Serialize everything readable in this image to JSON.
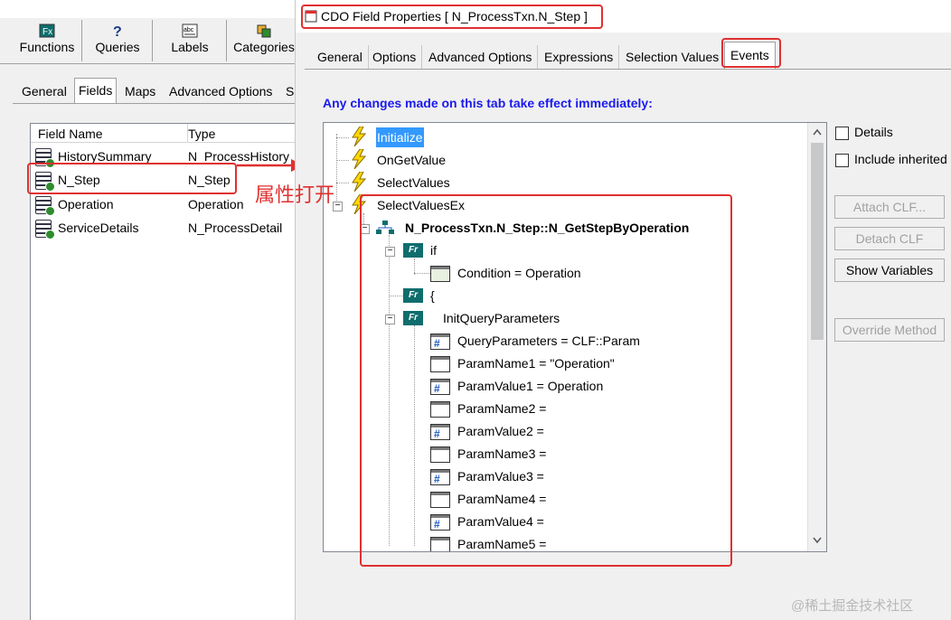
{
  "left": {
    "toolbar": [
      "Functions",
      "Queries",
      "Labels",
      "Categories"
    ],
    "tabs": [
      "General",
      "Fields",
      "Maps",
      "Advanced Options",
      "S"
    ],
    "selected_tab": "Fields",
    "columns": [
      "Field Name",
      "Type"
    ],
    "rows": [
      {
        "name": "HistorySummary",
        "type": "N_ProcessHistory"
      },
      {
        "name": "N_Step",
        "type": "N_Step"
      },
      {
        "name": "Operation",
        "type": "Operation"
      },
      {
        "name": "ServiceDetails",
        "type": "N_ProcessDetail"
      }
    ]
  },
  "annotation": {
    "text": "属性打开",
    "color": "#e03030"
  },
  "dialog": {
    "title": "CDO Field Properties [ N_ProcessTxn.N_Step ]",
    "tabs": [
      "General",
      "Options",
      "Advanced Options",
      "Expressions",
      "Selection Values",
      "Events"
    ],
    "selected_tab": "Events",
    "notice": "Any changes made on this tab take effect immediately:",
    "tree": [
      "Initialize",
      "OnGetValue",
      "SelectValues",
      "SelectValuesEx",
      "N_ProcessTxn.N_Step::N_GetStepByOperation",
      "if",
      "Condition = Operation",
      "{",
      "InitQueryParameters",
      "QueryParameters = CLF::Param",
      "ParamName1 = \"Operation\"",
      "ParamValue1 = Operation",
      "ParamName2 =",
      "ParamValue2 =",
      "ParamName3 =",
      "ParamValue3 =",
      "ParamName4 =",
      "ParamValue4 =",
      "ParamName5 ="
    ],
    "selected_node": "Initialize",
    "checkboxes": [
      {
        "label": "Details",
        "checked": false
      },
      {
        "label": "Include inherited",
        "checked": false
      }
    ],
    "buttons": {
      "attach": "Attach CLF...",
      "detach": "Detach CLF",
      "show_vars": "Show Variables",
      "override": "Override Method"
    }
  },
  "watermark": "@稀土掘金技术社区",
  "colors": {
    "highlight": "#e03030",
    "selection": "#3399ff",
    "notice": "#1a1aee",
    "method_icon": "#0f6d6d"
  }
}
